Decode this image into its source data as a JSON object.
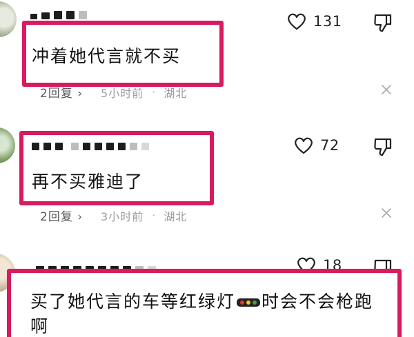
{
  "comments": [
    {
      "text": "冲着她代言就不买",
      "replies": "2回复",
      "time": "5小时前",
      "location": "湖北",
      "likes": "131"
    },
    {
      "text": "再不买雅迪了",
      "replies": "2回复",
      "time": "3小时前",
      "location": "湖北",
      "likes": "72"
    },
    {
      "text_before": "买了她代言的车等红绿灯",
      "text_after": "时会不会枪跑啊",
      "likes": "18"
    }
  ],
  "separator": "·",
  "reply_chevron": "›",
  "colors": {
    "highlight": "#d81b60",
    "meta_text": "#9b9b9b"
  },
  "icons": [
    "heart-icon",
    "dislike-icon",
    "close-icon",
    "traffic-light-emoji"
  ]
}
